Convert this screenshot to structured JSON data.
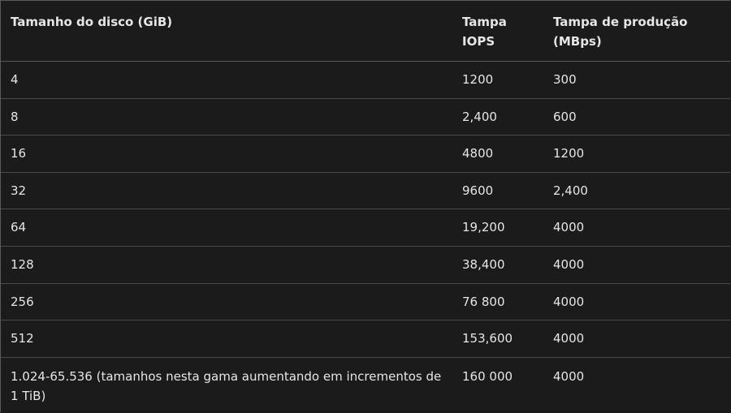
{
  "table": {
    "headers": [
      "Tamanho do disco (GiB)",
      "Tampa\nIOPS",
      "Tampa de produção\n(MBps)"
    ],
    "header_lines": {
      "col1": [
        "Tamanho do disco (GiB)"
      ],
      "col2": [
        "Tampa",
        "IOPS"
      ],
      "col3": [
        "Tampa de produção",
        "(MBps)"
      ]
    },
    "rows": [
      [
        "4",
        "1200",
        "300"
      ],
      [
        "8",
        "2,400",
        "600"
      ],
      [
        "16",
        "4800",
        "1200"
      ],
      [
        "32",
        "9600",
        "2,400"
      ],
      [
        "64",
        "19,200",
        "4000"
      ],
      [
        "128",
        "38,400",
        "4000"
      ],
      [
        "256",
        "76 800",
        "4000"
      ],
      [
        "512",
        "153,600",
        "4000"
      ],
      [
        "1.024-65.536 (tamanhos nesta gama aumentando em incrementos de 1 TiB)",
        "160 000",
        "4000"
      ]
    ]
  }
}
